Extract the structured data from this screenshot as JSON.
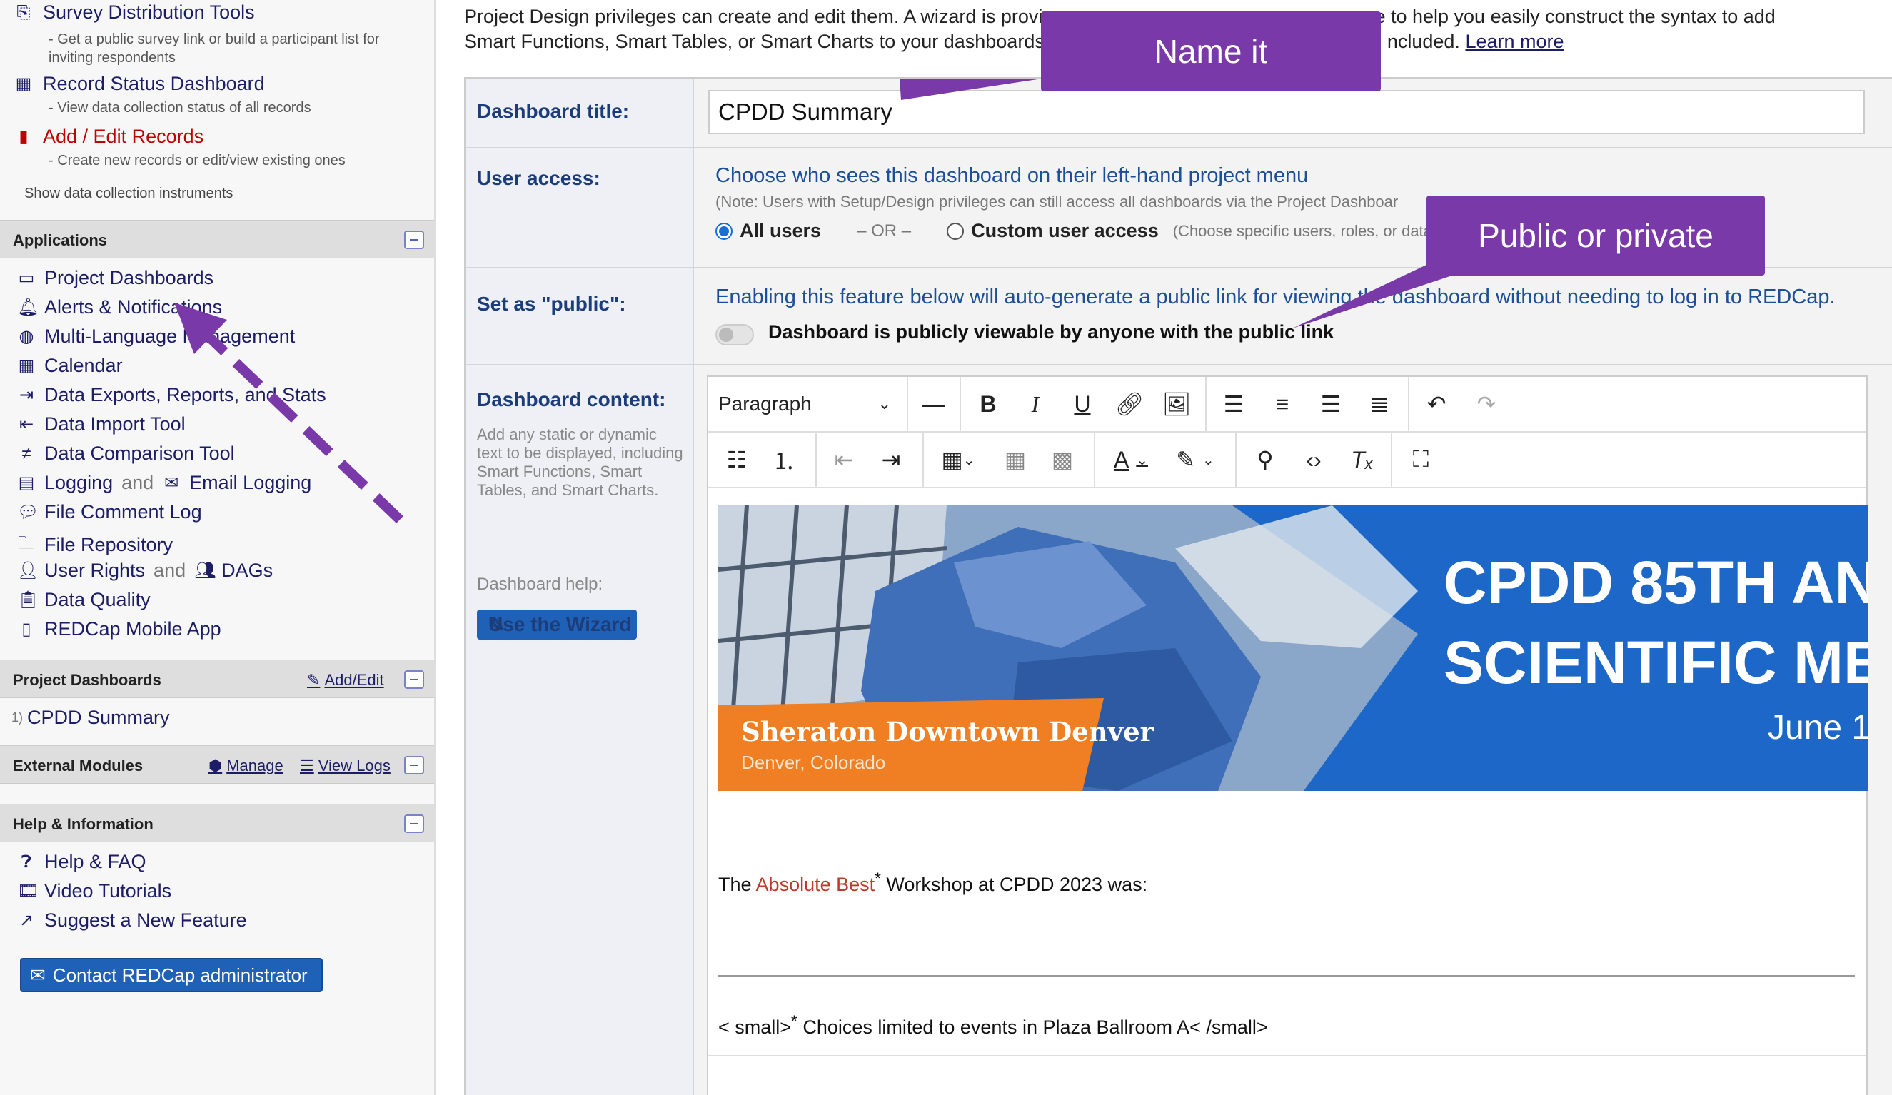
{
  "sidebar": {
    "survey_tools": {
      "label": "Survey Distribution Tools",
      "desc": "- Get a public survey link or build a participant list for inviting respondents"
    },
    "record_status": {
      "label": "Record Status Dashboard",
      "desc": "- View data collection status of all records"
    },
    "add_edit": {
      "label": "Add / Edit Records",
      "desc": "- Create new records or edit/view existing ones"
    },
    "show_instruments": "Show data collection instruments",
    "applications_title": "Applications",
    "apps": [
      "Project Dashboards",
      "Alerts & Notifications",
      "Multi-Language Management",
      "Calendar",
      "Data Exports, Reports, and Stats",
      "Data Import Tool",
      "Data Comparison Tool",
      "Logging",
      "File Comment Log",
      "File Repository",
      "User Rights",
      "Data Quality",
      "REDCap Mobile App"
    ],
    "logging_and": "and",
    "email_logging": "Email Logging",
    "user_rights_and": "and",
    "dags": "DAGs",
    "dashboards_title": "Project Dashboards",
    "dashboards_add_edit": "Add/Edit",
    "dashboard_item_num": "1)",
    "dashboard_item": "CPDD Summary",
    "ext_modules_title": "External Modules",
    "ext_manage": "Manage",
    "ext_view_logs": "View Logs",
    "help_title": "Help & Information",
    "help_items": [
      "Help & FAQ",
      "Video Tutorials",
      "Suggest a New Feature"
    ],
    "contact_btn": "Contact REDCap administrator"
  },
  "intro": {
    "line1": "Project Design privileges can create and edit them. A wizard is provi",
    "line1b": "page to help you easily construct the syntax to add",
    "line2": "Smart Functions, Smart Tables, or Smart Charts to your dashboards",
    "line2b": "ncluded.",
    "learn_more": "Learn more"
  },
  "form": {
    "title_label": "Dashboard title:",
    "title_value": "CPDD Summary",
    "access_label": "User access:",
    "access_heading": "Choose who sees this dashboard on their left-hand project menu",
    "access_note": "(Note: Users with Setup/Design privileges can still access all dashboards via the Project Dashboar",
    "all_users": "All users",
    "or": "– OR –",
    "custom_access": "Custom user access",
    "custom_note": "(Choose specific users, roles, or data a",
    "public_label": "Set as \"public\":",
    "public_desc": "Enabling this feature below will auto-generate a public link for viewing the dashboard without needing to log in to REDCap.",
    "public_toggle_label": "Dashboard is publicly viewable by anyone with the public link",
    "content_label": "Dashboard content:",
    "content_note": "Add any static or dynamic text to be displayed, including Smart Functions, Smart Tables, and Smart Charts.",
    "help_label": "Dashboard help:",
    "wizard_btn": "Use the Wizard"
  },
  "editor": {
    "paragraph_select": "Paragraph",
    "banner_title_1": "CPDD 85TH AN",
    "banner_title_2": "SCIENTIFIC ME",
    "banner_date": "June 1",
    "banner_venue": "Sheraton Downtown Denver",
    "banner_city": "Denver, Colorado",
    "text_pre": "The ",
    "text_red": "Absolute Best",
    "text_star": "*",
    "text_post": " Workshop at CPDD 2023 was:",
    "footnote_pre": "< small>",
    "footnote_star": "*",
    "footnote_post": " Choices limited to events in Plaza Ballroom A< /small>"
  },
  "callouts": {
    "name_it": "Name it",
    "public_private": "Public or private"
  },
  "colors": {
    "callout": "#7a39a8",
    "nav_text": "#1c1d66",
    "primary_button": "#2061b8"
  }
}
